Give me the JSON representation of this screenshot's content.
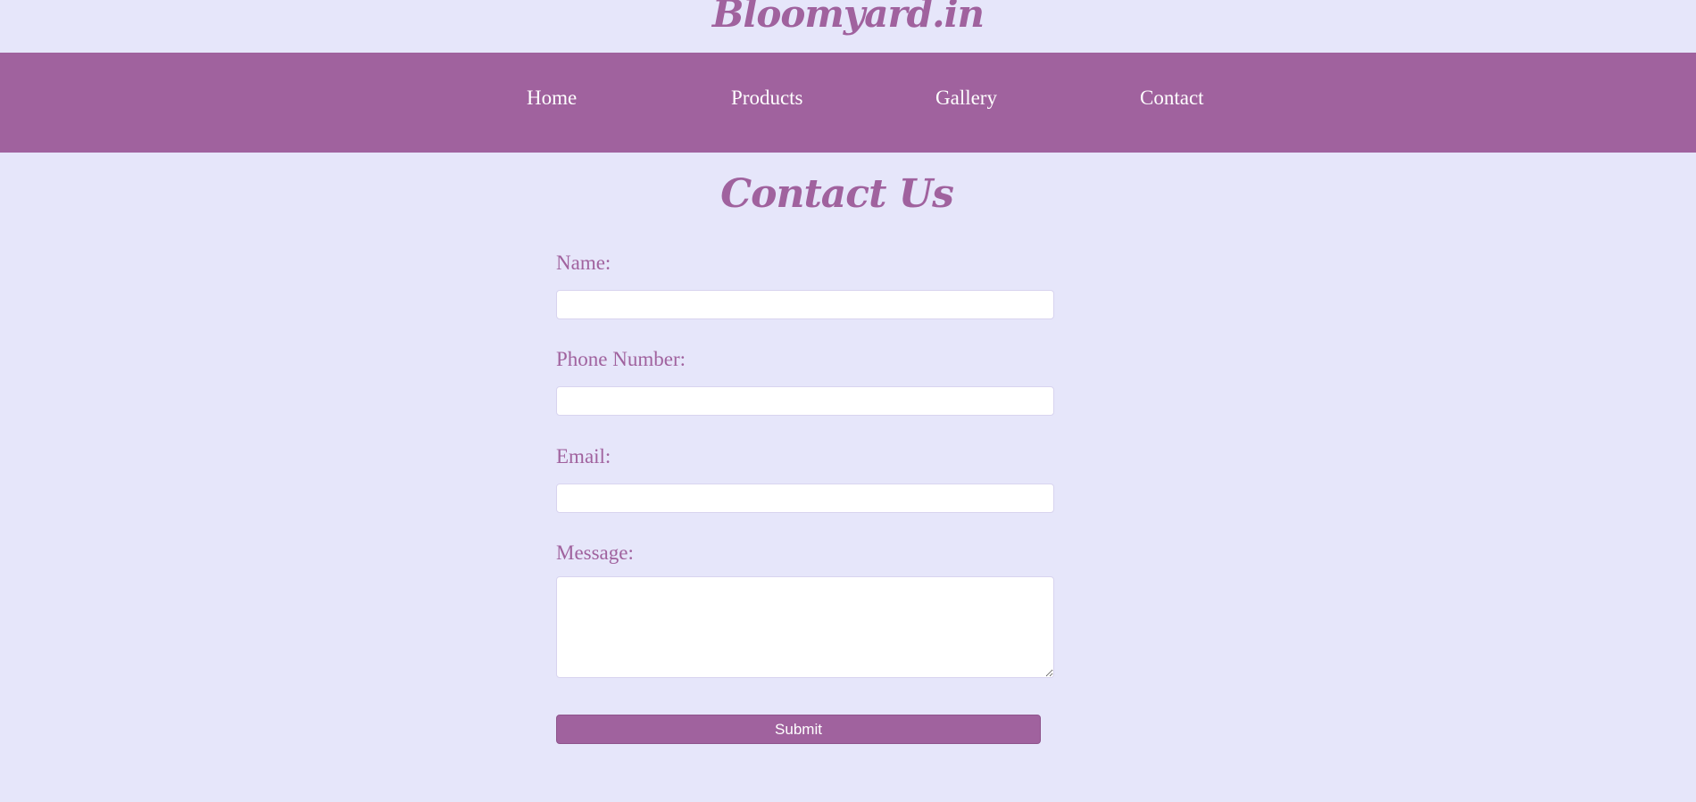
{
  "site": {
    "brand": "Bloomyard.in"
  },
  "nav": {
    "items": [
      {
        "label": "Home"
      },
      {
        "label": "Products"
      },
      {
        "label": "Gallery"
      },
      {
        "label": "Contact"
      }
    ]
  },
  "contact": {
    "title": "Contact Us",
    "name_label": "Name:",
    "name_value": "",
    "phone_label": "Phone Number:",
    "phone_value": "",
    "email_label": "Email:",
    "email_value": "",
    "message_label": "Message:",
    "message_value": "",
    "submit_label": "Submit"
  },
  "colors": {
    "background": "#e6e6fa",
    "accent": "#a0629e",
    "nav_text": "#ffffff"
  }
}
